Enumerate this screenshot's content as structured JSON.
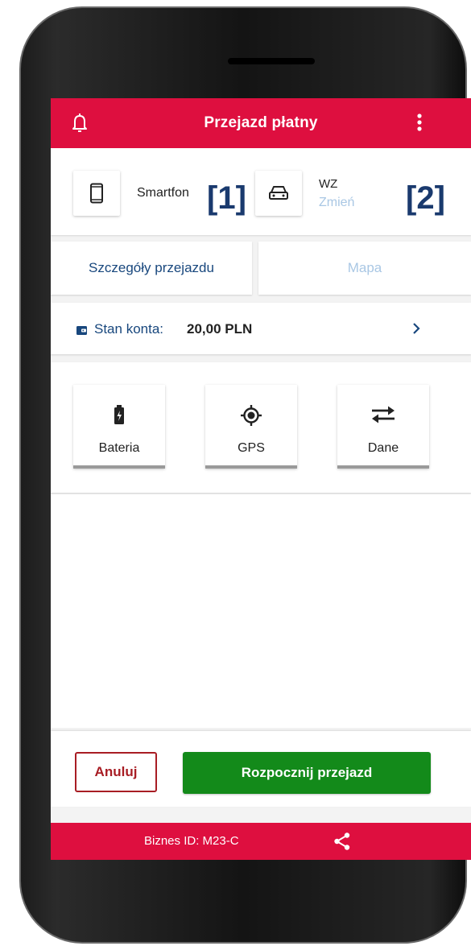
{
  "app": {
    "title": "Przejazd płatny"
  },
  "devices": {
    "phone_label": "Smartfon",
    "vehicle_label": "WZ",
    "vehicle_change": "Zmień",
    "marker1": "[1]",
    "marker2": "[2]"
  },
  "tabs": [
    {
      "label": "Szczegóły przejazdu",
      "active": true
    },
    {
      "label": "Mapa",
      "active": false
    }
  ],
  "balance": {
    "label": "Stan konta:",
    "value": "20,00 PLN"
  },
  "status_cards": [
    {
      "label": "Bateria",
      "icon": "battery-charging-icon"
    },
    {
      "label": "GPS",
      "icon": "gps-icon"
    },
    {
      "label": "Dane",
      "icon": "swap-arrows-icon"
    }
  ],
  "actions": {
    "cancel_label": "Anuluj",
    "start_label": "Rozpocznij przejazd"
  },
  "footer": {
    "business_id": "Biznes ID:  M23-C"
  },
  "colors": {
    "brand_red": "#de0f3f",
    "start_green": "#138a1a",
    "link_blue": "#18477d",
    "disabled_blue": "#a9c7e4"
  }
}
